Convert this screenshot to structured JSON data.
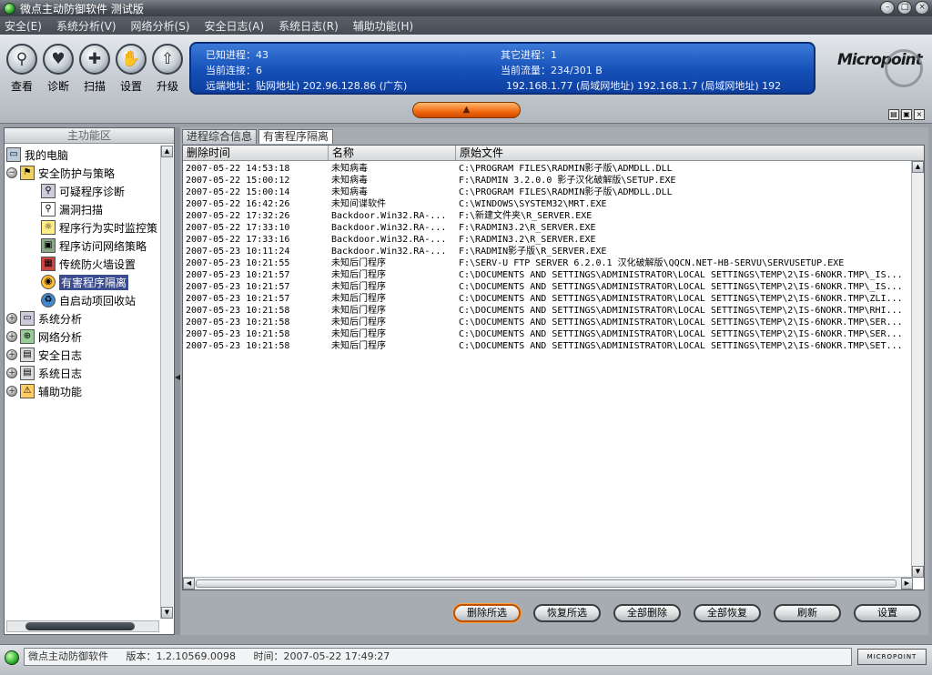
{
  "window": {
    "title": "微点主动防御软件  测试版"
  },
  "menu": [
    "安全(E)",
    "系统分析(V)",
    "网络分析(S)",
    "安全日志(A)",
    "系统日志(R)",
    "辅助功能(H)"
  ],
  "toolbar": {
    "buttons": [
      {
        "label": "查看",
        "icon": "magnifier-icon"
      },
      {
        "label": "诊断",
        "icon": "heart-icon"
      },
      {
        "label": "扫描",
        "icon": "scan-icon"
      },
      {
        "label": "设置",
        "icon": "hand-icon"
      },
      {
        "label": "升级",
        "icon": "upload-icon"
      }
    ]
  },
  "info": {
    "known_processes": "已知进程：43",
    "other_processes": "其它进程：1",
    "connections": "当前连接：6",
    "traffic": "当前流量：234/301 B",
    "remote": "远端地址：贴网地址)   202.96.128.86 (广东)",
    "remote2": "192.168.1.77 (局域网地址)    192.168.1.7 (局域网地址)    192"
  },
  "brand": "Micropoint",
  "left": {
    "header": "主功能区",
    "tree": [
      {
        "label": "我的电脑",
        "level": 0,
        "toggle": ""
      },
      {
        "label": "安全防护与策略",
        "level": 0,
        "toggle": "−"
      },
      {
        "label": "可疑程序诊断",
        "level": 1
      },
      {
        "label": "漏洞扫描",
        "level": 1
      },
      {
        "label": "程序行为实时监控策",
        "level": 1
      },
      {
        "label": "程序访问网络策略",
        "level": 1
      },
      {
        "label": "传统防火墙设置",
        "level": 1
      },
      {
        "label": "有害程序隔离",
        "level": 1,
        "selected": true
      },
      {
        "label": "自启动项回收站",
        "level": 1
      },
      {
        "label": "系统分析",
        "level": 0,
        "toggle": "+"
      },
      {
        "label": "网络分析",
        "level": 0,
        "toggle": "+"
      },
      {
        "label": "安全日志",
        "level": 0,
        "toggle": "+"
      },
      {
        "label": "系统日志",
        "level": 0,
        "toggle": "+"
      },
      {
        "label": "辅助功能",
        "level": 0,
        "toggle": "+"
      }
    ]
  },
  "tabs": [
    "进程综合信息",
    "有害程序隔离"
  ],
  "table": {
    "headers": [
      "删除时间",
      "名称",
      "原始文件"
    ],
    "rows": [
      [
        "2007-05-22 14:53:18",
        "未知病毒",
        "C:\\PROGRAM FILES\\RADMIN影子版\\ADMDLL.DLL"
      ],
      [
        "2007-05-22 15:00:12",
        "未知病毒",
        "F:\\RADMIN 3.2.0.0 影子汉化破解版\\SETUP.EXE"
      ],
      [
        "2007-05-22 15:00:14",
        "未知病毒",
        "C:\\PROGRAM FILES\\RADMIN影子版\\ADMDLL.DLL"
      ],
      [
        "2007-05-22 16:42:26",
        "未知间谍软件",
        "C:\\WINDOWS\\SYSTEM32\\MRT.EXE"
      ],
      [
        "2007-05-22 17:32:26",
        "Backdoor.Win32.RA-...",
        "F:\\新建文件夹\\R_SERVER.EXE"
      ],
      [
        "2007-05-22 17:33:10",
        "Backdoor.Win32.RA-...",
        "F:\\RADMIN3.2\\R_SERVER.EXE"
      ],
      [
        "2007-05-22 17:33:16",
        "Backdoor.Win32.RA-...",
        "F:\\RADMIN3.2\\R_SERVER.EXE"
      ],
      [
        "2007-05-23 10:11:24",
        "Backdoor.Win32.RA-...",
        "F:\\RADMIN影子版\\R_SERVER.EXE"
      ],
      [
        "2007-05-23 10:21:55",
        "未知后门程序",
        "F:\\SERV-U FTP SERVER 6.2.0.1 汉化破解版\\QQCN.NET-HB-SERVU\\SERVUSETUP.EXE"
      ],
      [
        "2007-05-23 10:21:57",
        "未知后门程序",
        "C:\\DOCUMENTS AND SETTINGS\\ADMINISTRATOR\\LOCAL SETTINGS\\TEMP\\2\\IS-6NOKR.TMP\\_IS..."
      ],
      [
        "2007-05-23 10:21:57",
        "未知后门程序",
        "C:\\DOCUMENTS AND SETTINGS\\ADMINISTRATOR\\LOCAL SETTINGS\\TEMP\\2\\IS-6NOKR.TMP\\_IS..."
      ],
      [
        "2007-05-23 10:21:57",
        "未知后门程序",
        "C:\\DOCUMENTS AND SETTINGS\\ADMINISTRATOR\\LOCAL SETTINGS\\TEMP\\2\\IS-6NOKR.TMP\\ZLI..."
      ],
      [
        "2007-05-23 10:21:58",
        "未知后门程序",
        "C:\\DOCUMENTS AND SETTINGS\\ADMINISTRATOR\\LOCAL SETTINGS\\TEMP\\2\\IS-6NOKR.TMP\\RHI..."
      ],
      [
        "2007-05-23 10:21:58",
        "未知后门程序",
        "C:\\DOCUMENTS AND SETTINGS\\ADMINISTRATOR\\LOCAL SETTINGS\\TEMP\\2\\IS-6NOKR.TMP\\SER..."
      ],
      [
        "2007-05-23 10:21:58",
        "未知后门程序",
        "C:\\DOCUMENTS AND SETTINGS\\ADMINISTRATOR\\LOCAL SETTINGS\\TEMP\\2\\IS-6NOKR.TMP\\SER..."
      ],
      [
        "2007-05-23 10:21:58",
        "未知后门程序",
        "C:\\DOCUMENTS AND SETTINGS\\ADMINISTRATOR\\LOCAL SETTINGS\\TEMP\\2\\IS-6NOKR.TMP\\SET..."
      ]
    ]
  },
  "actions": {
    "delete_selected": "删除所选",
    "restore_selected": "恢复所选",
    "delete_all": "全部删除",
    "restore_all": "全部恢复",
    "refresh": "刷新",
    "settings": "设置"
  },
  "status": {
    "app": "微点主动防御软件",
    "version": "版本：1.2.10569.0098",
    "time": "时间：2007-05-22 17:49:27",
    "logo": "MICROPOINT"
  },
  "colors": {
    "info_bg": "#1550b8",
    "accent_orange": "#f06a10",
    "selected": "#3a4d90"
  }
}
